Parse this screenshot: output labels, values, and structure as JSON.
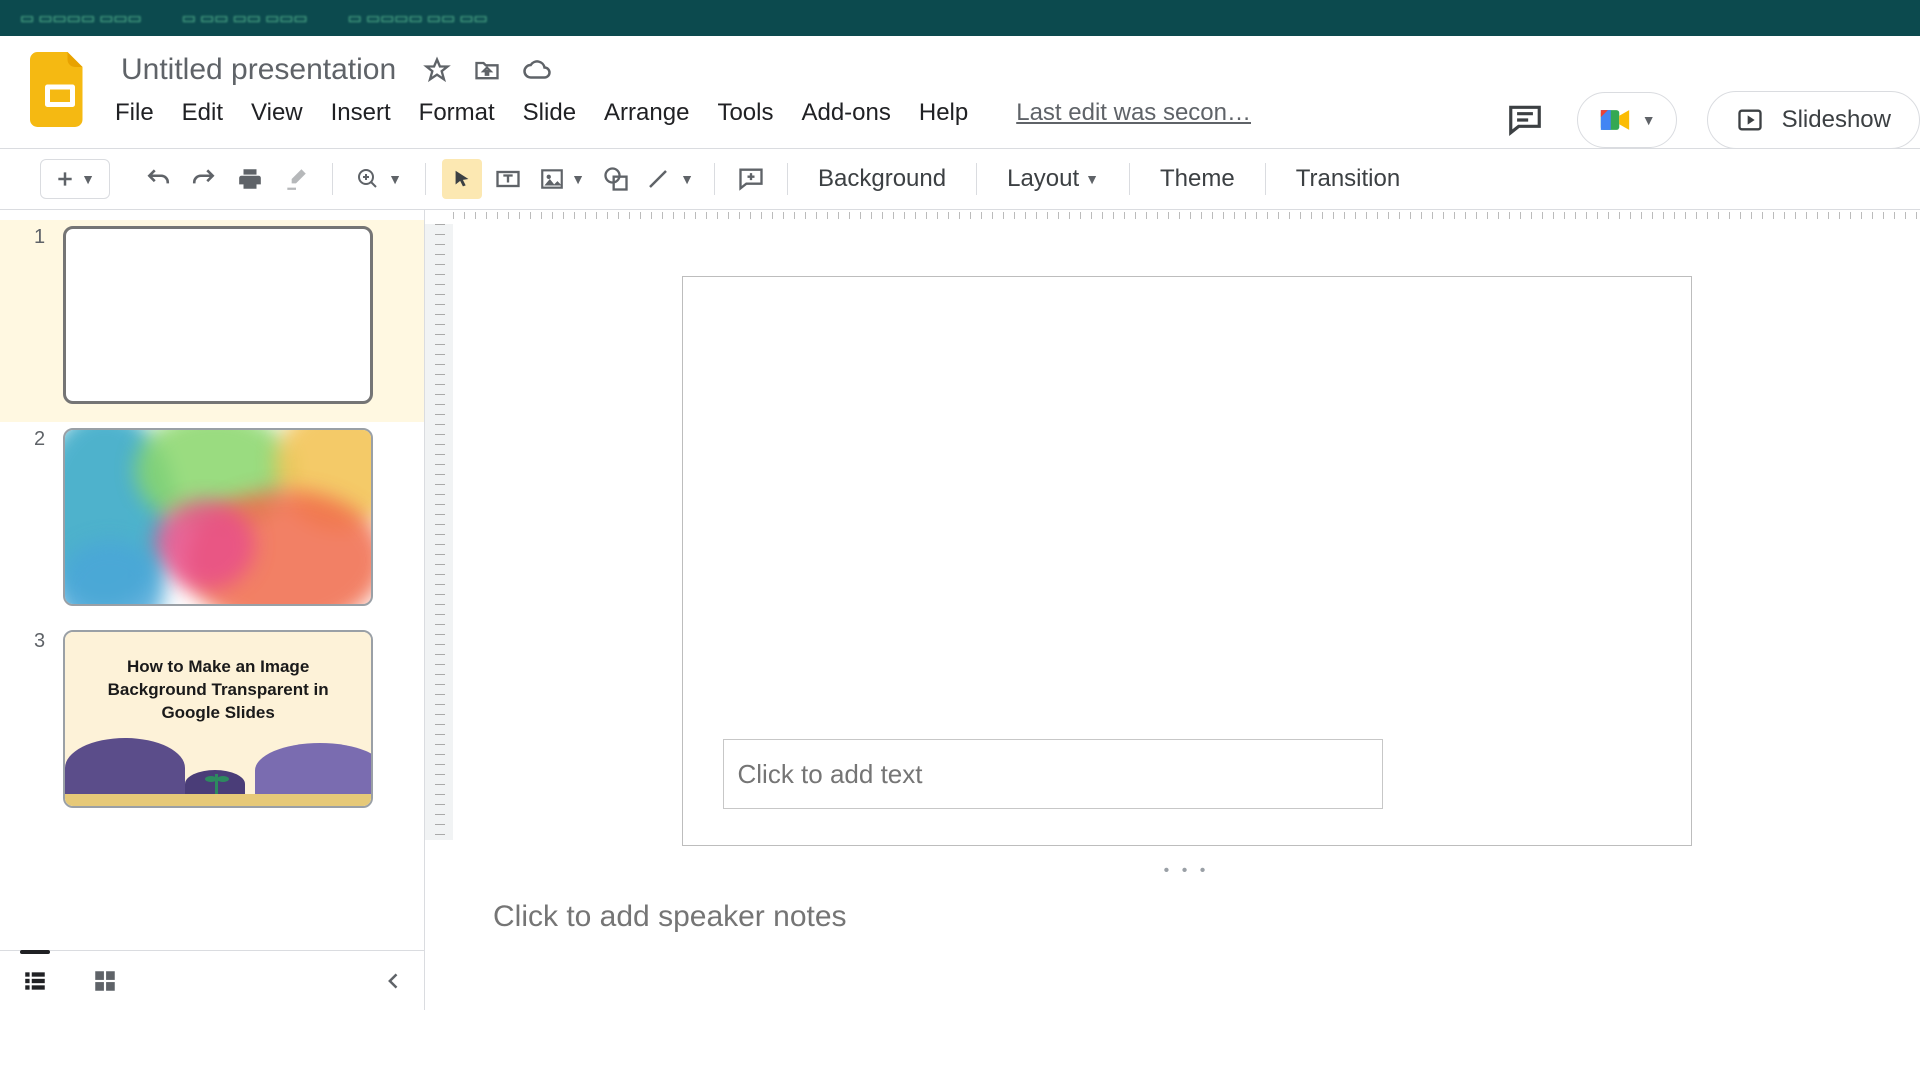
{
  "document": {
    "title": "Untitled presentation",
    "last_edit": "Last edit was secon…"
  },
  "menu": {
    "file": "File",
    "edit": "Edit",
    "view": "View",
    "insert": "Insert",
    "format": "Format",
    "slide": "Slide",
    "arrange": "Arrange",
    "tools": "Tools",
    "addons": "Add-ons",
    "help": "Help"
  },
  "header_right": {
    "slideshow": "Slideshow"
  },
  "toolbar": {
    "background": "Background",
    "layout": "Layout",
    "theme": "Theme",
    "transition": "Transition"
  },
  "thumbnails": {
    "slides": [
      {
        "number": "1"
      },
      {
        "number": "2"
      },
      {
        "number": "3",
        "title": "How to Make an Image Background Transparent in Google Slides"
      }
    ]
  },
  "canvas": {
    "text_placeholder": "Click to add text"
  },
  "notes": {
    "placeholder": "Click to add speaker notes"
  },
  "handle_dots": "•  •  •"
}
